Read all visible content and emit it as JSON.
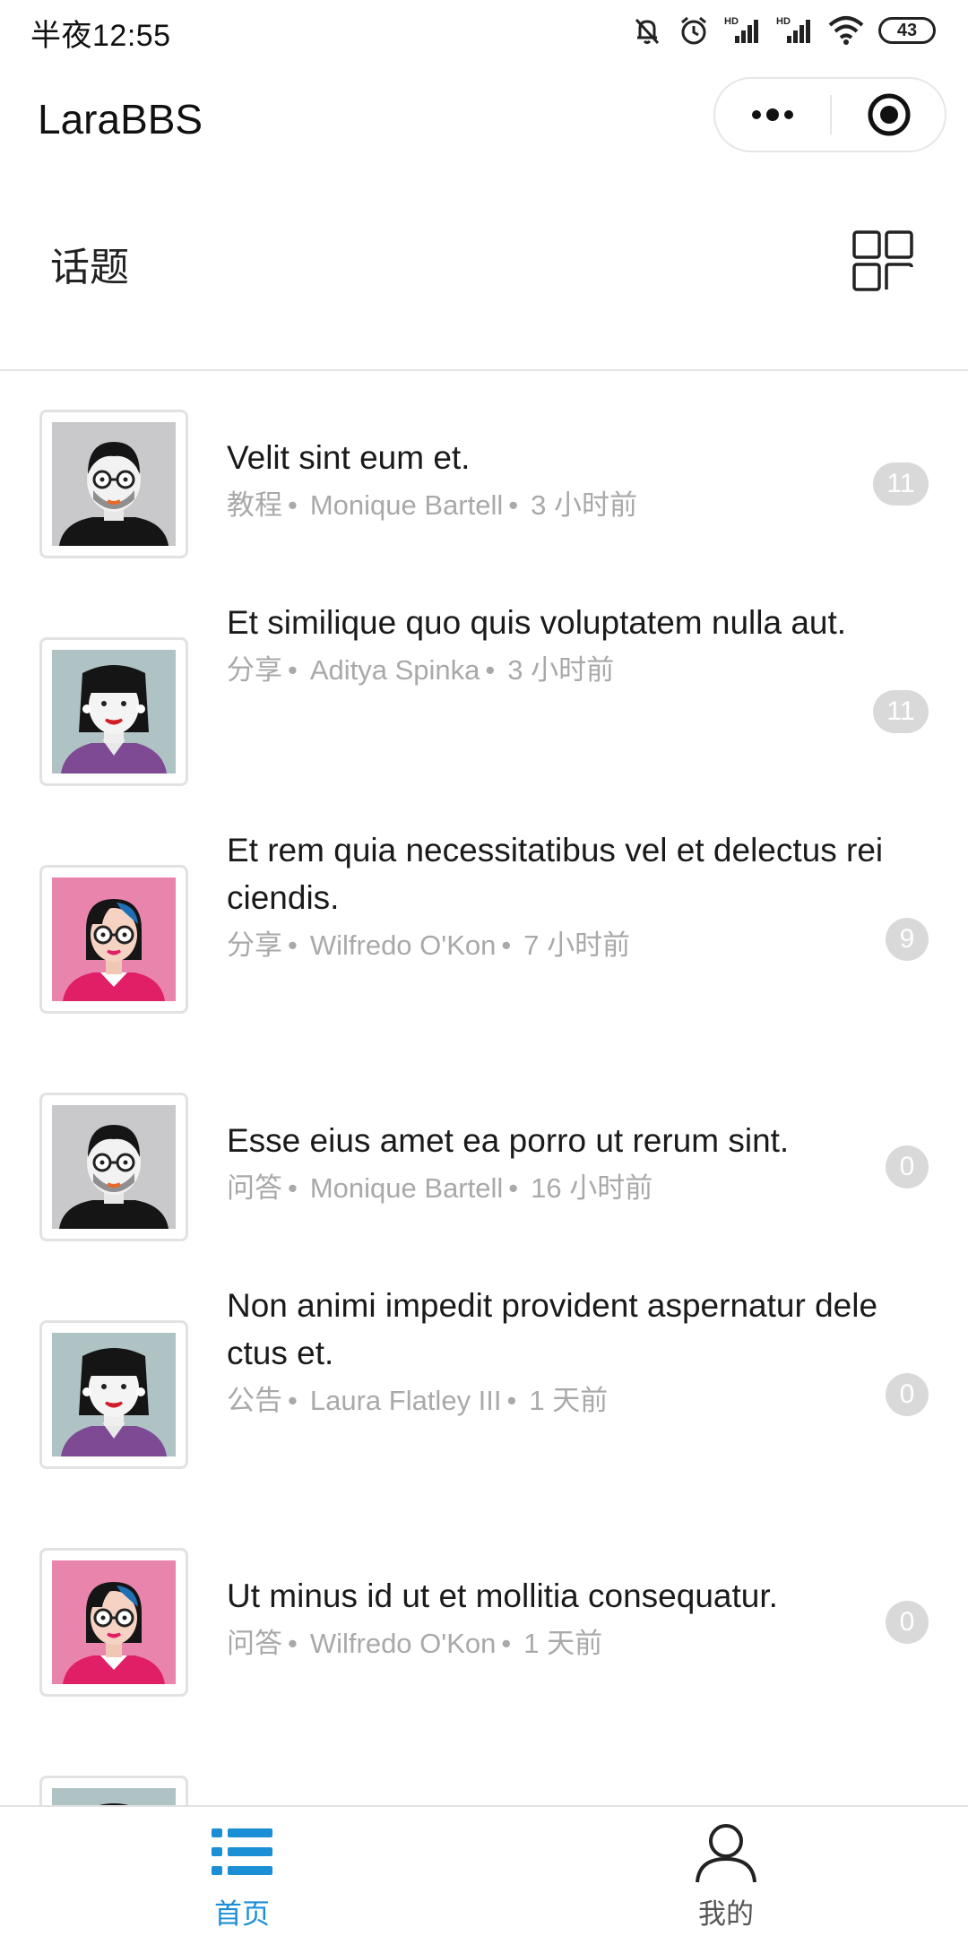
{
  "status_bar": {
    "time": "半夜12:55",
    "battery": "43"
  },
  "nav": {
    "title": "LaraBBS"
  },
  "category": {
    "title": "话题"
  },
  "topics": [
    {
      "title": "Velit sint eum et.",
      "category": "教程",
      "author": "Monique Bartell",
      "time": "3 小时前",
      "replies": "11"
    },
    {
      "title": "Et similique quo quis voluptatem nulla aut.",
      "category": "分享",
      "author": "Aditya Spinka",
      "time": "3 小时前",
      "replies": "11"
    },
    {
      "title": "Et rem quia necessitatibus vel et delectus reiciendis.",
      "category": "分享",
      "author": "Wilfredo O'Kon",
      "time": "7 小时前",
      "replies": "9"
    },
    {
      "title": "Esse eius amet ea porro ut rerum sint.",
      "category": "问答",
      "author": "Monique Bartell",
      "time": "16 小时前",
      "replies": "0"
    },
    {
      "title": "Non animi impedit provident aspernatur delectus et.",
      "category": "公告",
      "author": "Laura Flatley III",
      "time": "1 天前",
      "replies": "0"
    },
    {
      "title": "Ut minus id ut et mollitia consequatur.",
      "category": "问答",
      "author": "Wilfredo O'Kon",
      "time": "1 天前",
      "replies": "0"
    }
  ],
  "tabbar": {
    "home": {
      "label": "首页"
    },
    "mine": {
      "label": "我的"
    }
  },
  "colors": {
    "accent": "#1a8fd6",
    "badge": "#d9d9d9",
    "meta": "#a9a9a9"
  }
}
